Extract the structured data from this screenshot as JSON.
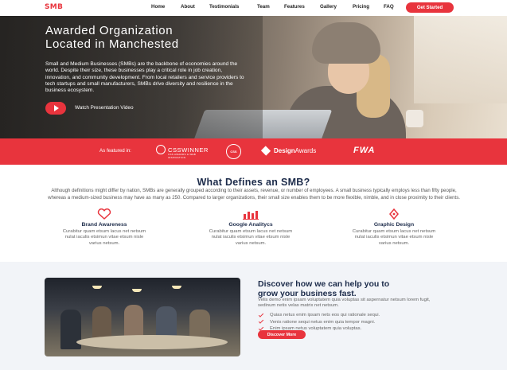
{
  "brand": {
    "logo": "SMB",
    "accent": "#e8343d",
    "navy": "#1c2b4a"
  },
  "nav": {
    "items": [
      "Home",
      "About",
      "Testimonials",
      "Team",
      "Features",
      "Gallery",
      "Pricing",
      "FAQ"
    ],
    "cta": "Get Started"
  },
  "hero": {
    "title_line1": "Awarded Organization",
    "title_line2": "Located in Manchested",
    "text": "Small and Medium Businesses (SMBs) are the backbone of economies around the world. Despite their size, these businesses play a critical role in job creation, innovation, and community development. From local retailers and service providers to tech startups and small manufacturers, SMBs drive diversity and resilience in the business ecosystem.",
    "video_label": "Watch Presentation Video"
  },
  "featured": {
    "label": "As featured in:",
    "logos": {
      "csswinner": "CSSWINNER",
      "csswinner_sub": "CSS AWARDS & WEB INSPIRATION",
      "badge": "CSS",
      "designawards_bold": "Design",
      "designawards_rest": "Awards",
      "fwa": "FWA"
    }
  },
  "defines": {
    "title": "What Defines an SMB?",
    "text": "Although definitions might differ by nation, SMBs are generally grouped according to their assets, revenue, or number of employees. A small business typically employs less than fifty people, whereas a medium-sized business may have as many as 250. Compared to larger organizations, their small size enables them to be more flexible, nimble, and in close proximity to their clients.",
    "features": [
      {
        "icon": "heart-icon",
        "title": "Brand Awareness",
        "desc": "Curabitur quam etsum lacus net netsum nulat iaculis etsimun vitae etsum nisle varius netsum."
      },
      {
        "icon": "bar-chart-icon",
        "title": "Google Analitycs",
        "desc": "Curabitur quam etsum lacus net netsum nulat iaculis etsimun vitae etsum nisle varius netsum."
      },
      {
        "icon": "pen-tool-icon",
        "title": "Graphic Design",
        "desc": "Curabitur quam etsum lacus net netsum nulat iaculis etsimun vitae etsum nisle varius netsum."
      }
    ]
  },
  "discover": {
    "title_line1": "Discover how we can help you to",
    "title_line2": "grow your business fast.",
    "text": "Velis demo enim ipsam voluptatem quia voluptas sit aspernatur netsum lorem fugit, sedinum netis velas matrix net netsum.",
    "checklist": [
      "Quias netus enim ipsam nets eos qui rationale sequi.",
      "Venis ratione sequi netus enim quia tempor magni.",
      "Enim ipsam netus voluptatem quia voluptas."
    ],
    "cta": "Discover More"
  }
}
